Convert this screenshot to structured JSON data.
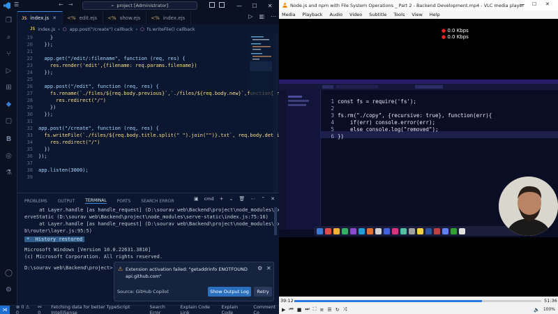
{
  "vscode": {
    "search": "project [Administrator]",
    "tabs": [
      {
        "label": "index.js",
        "active": true
      },
      {
        "label": "edit.ejs",
        "active": false
      },
      {
        "label": "show.ejs",
        "active": false
      },
      {
        "label": "index.ejs",
        "active": false
      }
    ],
    "breadcrumb": [
      "index.js",
      "app.post(\"/create\") callback",
      "fs.writeFile() callback"
    ],
    "code": [
      {
        "n": "19",
        "t": "    }"
      },
      {
        "n": "20",
        "t": "  });"
      },
      {
        "n": "21",
        "t": ""
      },
      {
        "n": "22",
        "t": "  app.get(\"/edit/:filename\", function (req, res) {"
      },
      {
        "n": "23",
        "t": "    res.render('edit',{filename: req.params.filename})"
      },
      {
        "n": "24",
        "t": "  });"
      },
      {
        "n": "25",
        "t": ""
      },
      {
        "n": "26",
        "t": "  app.post(\"/edit\", function (req, res) {"
      },
      {
        "n": "27",
        "t": "    fs.rename(`./files/${req.body.previous}`,`./files/${req.body.new}`,function(err"
      },
      {
        "n": "28",
        "t": "      res.redirect(\"/\")"
      },
      {
        "n": "29",
        "t": "    })"
      },
      {
        "n": "30",
        "t": "  });"
      },
      {
        "n": "31",
        "t": ""
      },
      {
        "n": "32",
        "t": "app.post(\"/create\", function (req, res) {"
      },
      {
        "n": "33",
        "t": "  fs.writeFile(`./files/${req.body.title.split(\" \").join(\"\")}.txt`, req.body.detail"
      },
      {
        "n": "34",
        "t": "    res.redirect(\"/\")"
      },
      {
        "n": "35",
        "t": "  })"
      },
      {
        "n": "36",
        "t": "});"
      },
      {
        "n": "37",
        "t": ""
      },
      {
        "n": "38",
        "t": "app.listen(3000);"
      },
      {
        "n": "39",
        "t": ""
      }
    ],
    "panel_tabs": [
      "PROBLEMS",
      "OUTPUT",
      "TERMINAL",
      "PORTS",
      "SEARCH ERROR"
    ],
    "panel_shell": "cmd",
    "terminal": [
      "     at Layer.handle [as handle_request] (D:\\sourav web\\Backend\\project\\node_modules\\ex     at s",
      "erveStatic (D:\\sourav web\\Backend\\project\\node_modules\\serve-static\\index.js:75:16)",
      "     at Layer.handle [as handle_request] (D:\\sourav web\\Backend\\project\\node_modules\\express\\li",
      "b\\router\\layer.js:95:5)"
    ],
    "history": "*  History restored",
    "terminal2": [
      "Microsoft Windows [Version 10.0.22631.3810]",
      "(c) Microsoft Corporation. All rights reserved."
    ],
    "prompt": "D:\\sourav web\\Backend\\project>",
    "notification": {
      "message": "Extension activation failed: \"getaddrinfo ENOTFOUND api.github.com\"",
      "source": "Source: GitHub Copilot",
      "btn_log": "Show Output Log",
      "btn_retry": "Retry"
    },
    "status": {
      "errors": "0",
      "warnings": "0",
      "remote": "0",
      "fetching": "Fetching data for better TypeScript IntelliSense",
      "search_error": "Search Error",
      "explain": "Explain Code Link",
      "explain2": "Explain Code",
      "comment": "Comment Co"
    }
  },
  "vlc": {
    "title": "Node.js and npm with File System Operations _ Part 2 - Backend Development.mp4 - VLC media player",
    "menu": [
      "Media",
      "Playback",
      "Audio",
      "Video",
      "Subtitle",
      "Tools",
      "View",
      "Help"
    ],
    "kbps": [
      "0.0 Kbps",
      "0.0 Kbps"
    ],
    "inner_code": [
      {
        "n": "1",
        "t": "const fs = require('fs');"
      },
      {
        "n": "2",
        "t": ""
      },
      {
        "n": "3",
        "t": "fs.rm(\"./copy\", {recursive: true}, function(err){"
      },
      {
        "n": "4",
        "t": "    if(err) console.error(err);"
      },
      {
        "n": "5",
        "t": "    else console.log(\"removed\");"
      },
      {
        "n": "6",
        "t": "})"
      }
    ],
    "time_elapsed": "39:12",
    "time_total": "51:36",
    "progress": 0.76,
    "volume": "100%"
  }
}
